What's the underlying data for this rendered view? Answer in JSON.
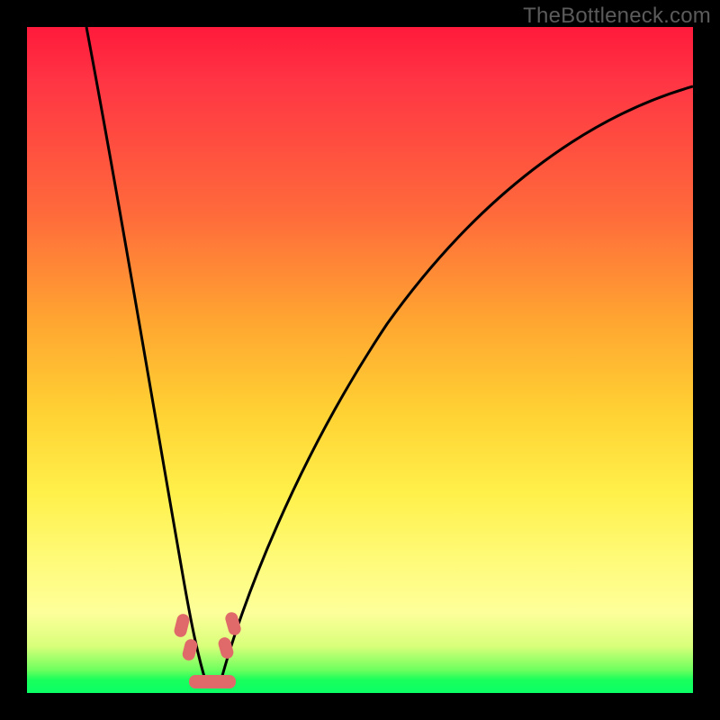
{
  "watermark": "TheBottleneck.com",
  "colors": {
    "frame_bg": "#000000",
    "curve_stroke": "#000000",
    "marker_fill": "#e06a6a",
    "gradient_top": "#ff1a3b",
    "gradient_mid": "#ffe24a",
    "gradient_bottom": "#0aff66"
  },
  "chart_data": {
    "type": "line",
    "title": "",
    "xlabel": "",
    "ylabel": "",
    "xlim": [
      0,
      100
    ],
    "ylim": [
      0,
      100
    ],
    "series": [
      {
        "name": "left-curve",
        "x": [
          9,
          11,
          13,
          15,
          17,
          19,
          20,
          21,
          22,
          23,
          24,
          25,
          26
        ],
        "y": [
          100,
          88,
          76,
          64,
          52,
          40,
          33,
          26,
          19,
          13,
          8,
          4,
          1
        ]
      },
      {
        "name": "right-curve",
        "x": [
          30,
          32,
          35,
          40,
          46,
          54,
          64,
          76,
          88,
          100
        ],
        "y": [
          1,
          6,
          14,
          26,
          40,
          54,
          67,
          78,
          86,
          91
        ]
      }
    ],
    "markers": [
      {
        "name": "left-marker-upper",
        "x": 23.5,
        "y": 9
      },
      {
        "name": "left-marker-lower",
        "x": 24.5,
        "y": 5
      },
      {
        "name": "right-marker-upper",
        "x": 31.0,
        "y": 9
      },
      {
        "name": "right-marker-lower",
        "x": 30.0,
        "y": 5
      },
      {
        "name": "bottom-blob-left",
        "x": 26.0,
        "y": 1.5
      },
      {
        "name": "bottom-blob-right",
        "x": 30.0,
        "y": 1.5
      }
    ]
  }
}
